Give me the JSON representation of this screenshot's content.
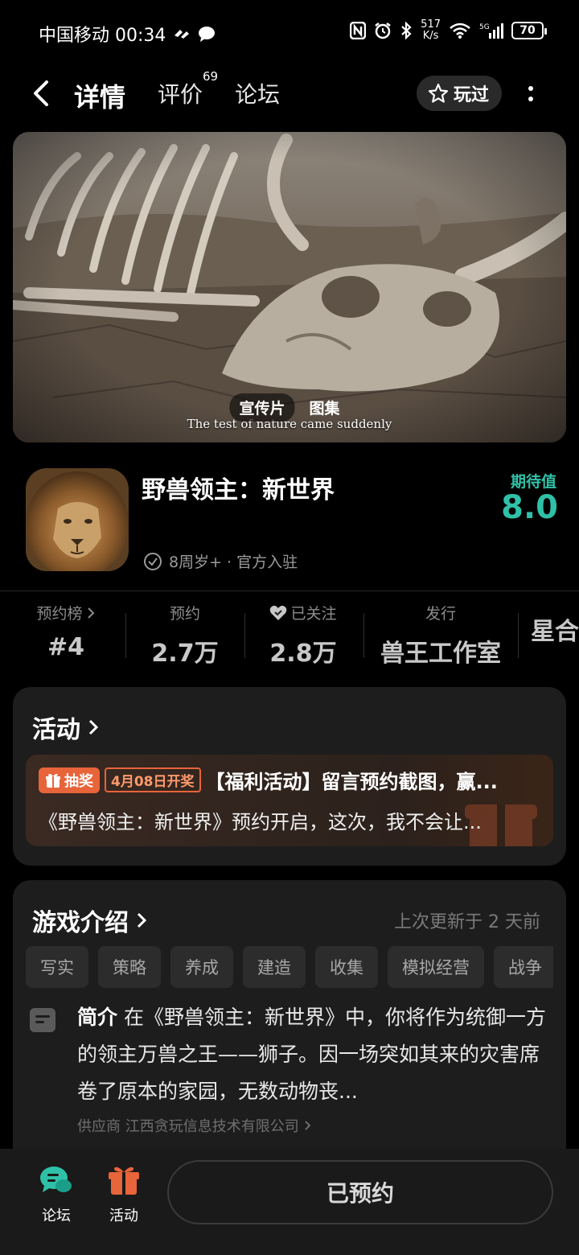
{
  "status_bar": {
    "carrier_time": "中国移动 00:34",
    "net_speed_value": "517",
    "net_speed_unit": "K/s",
    "battery": "70"
  },
  "nav": {
    "tabs": [
      {
        "label": "详情"
      },
      {
        "label": "评价",
        "badge": "69"
      },
      {
        "label": "论坛"
      }
    ],
    "played_label": "玩过"
  },
  "hero": {
    "subtitle": "The test of nature came suddenly",
    "pills": [
      "宣传片",
      "图集"
    ]
  },
  "game": {
    "title": "野兽领主：新世界",
    "meta": "8周岁+ · 官方入驻",
    "expect_label": "期待值",
    "expect_value": "8.0"
  },
  "stats": [
    {
      "label": "预约榜",
      "value": "#4"
    },
    {
      "label": "预约",
      "value": "2.7万"
    },
    {
      "label": "已关注",
      "value": "2.8万"
    },
    {
      "label": "发行",
      "value": "兽王工作室"
    },
    {
      "label": "",
      "value": "星合"
    }
  ],
  "activity": {
    "header": "活动",
    "badge": "抽奖",
    "date_badge": "4月08日开奖",
    "title": "【福利活动】留言预约截图，赢...",
    "desc": "《野兽领主：新世界》预约开启，这次，我不会让..."
  },
  "intro": {
    "header": "游戏介绍",
    "updated": "上次更新于 2 天前",
    "tags": [
      "写实",
      "策略",
      "养成",
      "建造",
      "收集",
      "模拟经营",
      "战争"
    ],
    "label": "简介",
    "text": "在《野兽领主：新世界》中，你将作为统御一方的领主万兽之王——狮子。因一场突如其来的灾害席卷了原本的家园，无数动物丧...",
    "supplier": "供应商 江西贪玩信息技术有限公司"
  },
  "bottom": {
    "forum": "论坛",
    "activity": "活动",
    "reserve": "已预约"
  },
  "colors": {
    "accent": "#2fc1a8",
    "tab_highlight": "#15b5a0",
    "lottery": "#e8643a",
    "card_bg": "#1d1d1d"
  }
}
